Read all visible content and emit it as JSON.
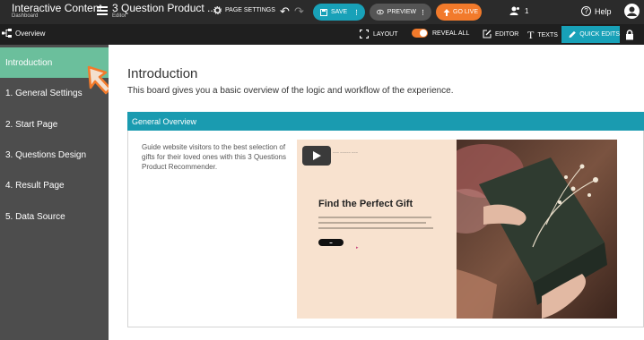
{
  "topbar": {
    "app_title": "Interactive Content",
    "app_subtitle": "Dashboard",
    "project_title": "3 Question Product ...",
    "project_subtitle": "Editor",
    "page_settings": "PAGE SETTINGS",
    "save": "SAVE",
    "preview": "PREVIEW",
    "go_live": "GO LIVE",
    "user_count": "1",
    "help": "Help"
  },
  "subbar": {
    "overview": "Overview",
    "layout": "LAYOUT",
    "reveal_all": "REVEAL ALL",
    "editor": "EDITOR",
    "texts": "TEXTS",
    "quick_edits": "QUICK EDITS"
  },
  "sidebar": {
    "items": [
      {
        "label": "Introduction"
      },
      {
        "label": "1. General Settings"
      },
      {
        "label": "2. Start Page"
      },
      {
        "label": "3. Questions Design"
      },
      {
        "label": "4. Result Page"
      },
      {
        "label": "5. Data Source"
      }
    ]
  },
  "main": {
    "title": "Introduction",
    "description": "This board gives you a basic overview of the logic and workflow of the experience.",
    "panel_title": "General Overview",
    "panel_text": "Guide website visitors to the best selection of gifts for their loved ones with this 3 Questions Product Recommender.",
    "video_heading": "Find the Perfect Gift"
  },
  "colors": {
    "accent_teal": "#18a1b8",
    "go_live_orange": "#f27a2b",
    "sidebar_active": "#6bbf9c",
    "topbar_bg": "#2b2b2b"
  },
  "icons": [
    "menu-icon",
    "gear-icon",
    "undo-icon",
    "redo-icon",
    "eye-icon",
    "upload-icon",
    "users-icon",
    "help-icon",
    "account-icon",
    "overview-icon",
    "layout-icon",
    "editor-icon",
    "pencil-icon",
    "lock-icon",
    "play-icon",
    "cursor-arrow-icon"
  ]
}
